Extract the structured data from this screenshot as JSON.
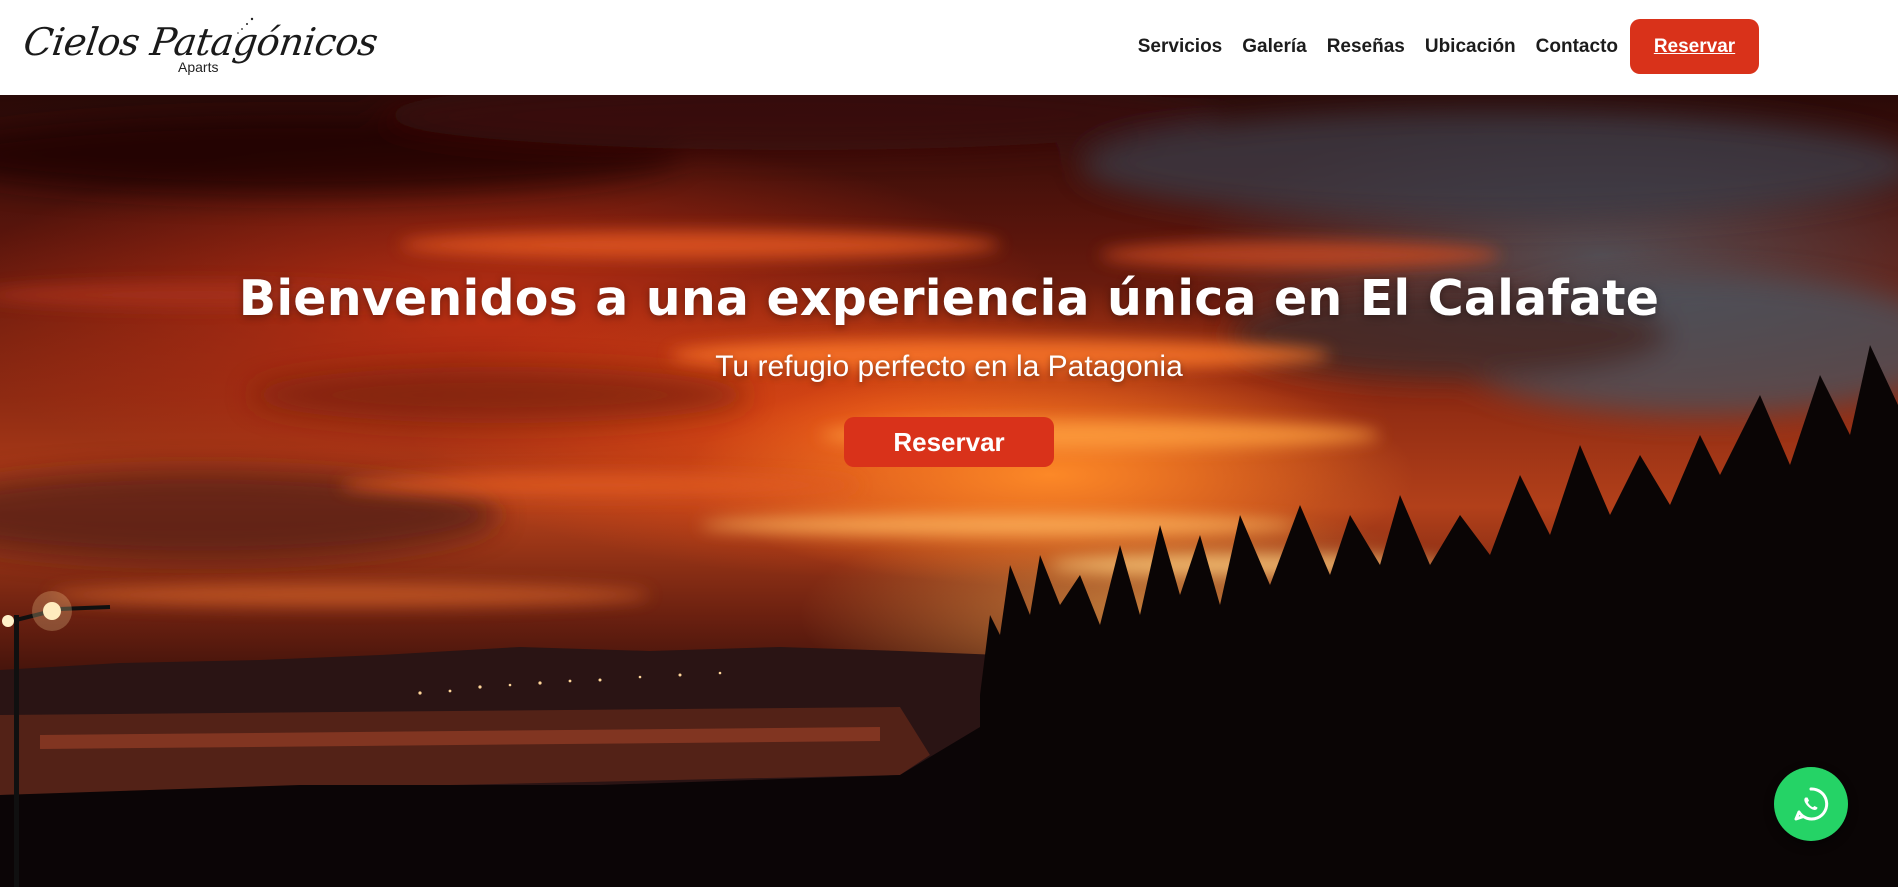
{
  "brand": {
    "logo_script": "Cielos Patagónicos",
    "logo_sub": "Aparts"
  },
  "nav": {
    "items": [
      {
        "label": "Servicios"
      },
      {
        "label": "Galería"
      },
      {
        "label": "Reseñas"
      },
      {
        "label": "Ubicación"
      },
      {
        "label": "Contacto"
      }
    ],
    "reserve_label": "Reservar"
  },
  "hero": {
    "title": "Bienvenidos a una experiencia única en El Calafate",
    "subtitle": "Tu refugio perfecto en la Patagonia",
    "cta_label": "Reservar"
  },
  "colors": {
    "accent": "#d9321a",
    "whatsapp": "#25d366",
    "header_bg": "#ffffff",
    "nav_text": "#1c1c1c"
  },
  "icons": {
    "whatsapp": "whatsapp-icon",
    "stars": "stars-icon"
  }
}
